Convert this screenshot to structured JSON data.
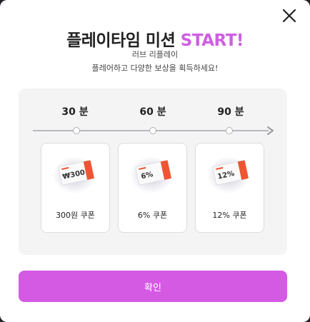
{
  "modal": {
    "title_main": "플레이타임 미션",
    "title_accent": "START!",
    "subtitle": "러브 리플레이",
    "description": "플레어하고 다양한 보상을 획득하세요!",
    "confirm_label": "확인"
  },
  "milestones": [
    {
      "time": "30 분",
      "coupon_value": "₩300",
      "reward_label": "300원 쿠폰"
    },
    {
      "time": "60 분",
      "coupon_value": "6%",
      "reward_label": "6% 쿠폰"
    },
    {
      "time": "90 분",
      "coupon_value": "12%",
      "reward_label": "12% 쿠폰"
    }
  ],
  "colors": {
    "accent": "#cf5ee3",
    "button": "#d45ae4",
    "ticket_tab": "#ee5533"
  },
  "icons": {
    "close": "close-icon",
    "arrow": "arrow-right-icon"
  }
}
